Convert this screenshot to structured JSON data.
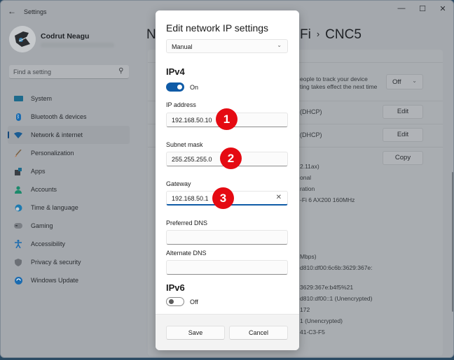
{
  "window": {
    "title": "Settings",
    "back_icon": "←",
    "minimize_icon": "—",
    "maximize_icon": "☐",
    "close_icon": "✕"
  },
  "profile": {
    "name": "Codrut Neagu"
  },
  "search": {
    "placeholder": "Find a setting",
    "icon": "⚲"
  },
  "sidebar": {
    "items": [
      {
        "label": "System",
        "icon": "system-icon",
        "active": false
      },
      {
        "label": "Bluetooth & devices",
        "icon": "bluetooth-icon",
        "active": false
      },
      {
        "label": "Network & internet",
        "icon": "wifi-icon",
        "active": true
      },
      {
        "label": "Personalization",
        "icon": "brush-icon",
        "active": false
      },
      {
        "label": "Apps",
        "icon": "apps-icon",
        "active": false
      },
      {
        "label": "Accounts",
        "icon": "person-icon",
        "active": false
      },
      {
        "label": "Time & language",
        "icon": "globe-clock-icon",
        "active": false
      },
      {
        "label": "Gaming",
        "icon": "gamepad-icon",
        "active": false
      },
      {
        "label": "Accessibility",
        "icon": "accessibility-icon",
        "active": false
      },
      {
        "label": "Privacy & security",
        "icon": "shield-icon",
        "active": false
      },
      {
        "label": "Windows Update",
        "icon": "update-icon",
        "active": false
      }
    ]
  },
  "main": {
    "breadcrumb_start": "N",
    "breadcrumb_partial": "Fi",
    "breadcrumb_sep": "›",
    "breadcrumb_current": "CNC5",
    "random_hw_text_1": "eople to track your device",
    "random_hw_text_2": "ting takes effect the next time",
    "random_hw_value": "Off",
    "ip_assign_value": "(DHCP)",
    "dns_assign_value": "(DHCP)",
    "edit_label": "Edit",
    "edit_label_2": "Edit",
    "copy_label": "Copy",
    "props": [
      "2.11ax)",
      "onal",
      "ration",
      "-Fi 6 AX200 160MHz",
      "Mbps)",
      "d810:df00:6c6b:3629:367e:",
      "3629:367e:b4f5%21",
      "d810:df00::1 (Unencrypted)",
      "172",
      "1 (Unencrypted)",
      "41-C3-F5"
    ]
  },
  "dialog": {
    "title": "Edit network IP settings",
    "mode_value": "Manual",
    "ipv4": {
      "heading": "IPv4",
      "toggle_state": "On",
      "ip_label": "IP address",
      "ip_value": "192.168.50.10",
      "subnet_label": "Subnet mask",
      "subnet_value": "255.255.255.0",
      "gateway_label": "Gateway",
      "gateway_value": "192.168.50.1",
      "clear_icon": "✕",
      "pref_dns_label": "Preferred DNS",
      "pref_dns_value": "",
      "alt_dns_label": "Alternate DNS",
      "alt_dns_value": ""
    },
    "ipv6": {
      "heading": "IPv6",
      "toggle_state": "Off"
    },
    "save_label": "Save",
    "cancel_label": "Cancel"
  },
  "annotations": {
    "badge_1": "1",
    "badge_2": "2",
    "badge_3": "3",
    "badge_color": "#e50a12"
  }
}
